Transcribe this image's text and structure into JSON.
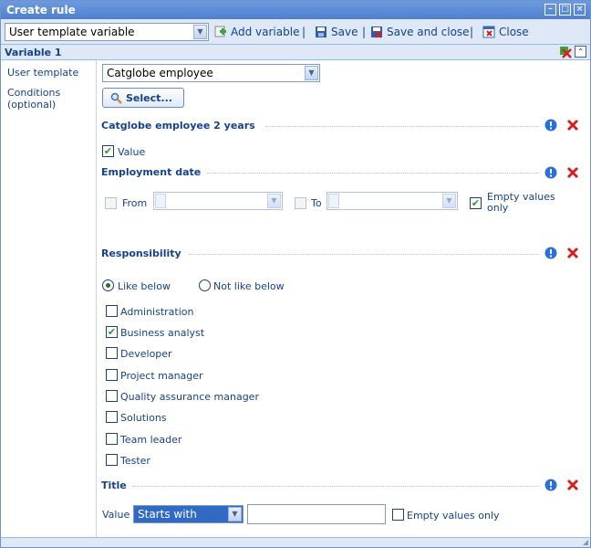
{
  "window": {
    "title": "Create rule"
  },
  "toolbar": {
    "type_select": "User template variable",
    "add_variable": "Add variable",
    "save": "Save",
    "save_close": "Save and close",
    "close": "Close",
    "separator": "|"
  },
  "variable": {
    "header": "Variable 1",
    "user_template_label": "User template",
    "user_template_value": "Catglobe employee",
    "conditions_label": "Conditions\n(optional)",
    "select_button": "Select..."
  },
  "sections": {
    "employee2y": {
      "title": "Catglobe employee 2 years",
      "value_label": "Value",
      "value_checked": true
    },
    "employment": {
      "title": "Employment date",
      "from_label": "From",
      "to_label": "To",
      "empty_label": "Empty values only",
      "empty_checked": true
    },
    "responsibility": {
      "title": "Responsibility",
      "like_label": "Like below",
      "not_like_label": "Not like below",
      "selected_mode": "like",
      "items": [
        {
          "label": "Administration",
          "checked": false
        },
        {
          "label": "Business analyst",
          "checked": true
        },
        {
          "label": "Developer",
          "checked": false
        },
        {
          "label": "Project manager",
          "checked": false
        },
        {
          "label": "Quality assurance manager",
          "checked": false
        },
        {
          "label": "Solutions",
          "checked": false
        },
        {
          "label": "Team leader",
          "checked": false
        },
        {
          "label": "Tester",
          "checked": false
        }
      ]
    },
    "title_section": {
      "title": "Title",
      "value_label": "Value",
      "operator": "Starts with",
      "input_value": "",
      "empty_label": "Empty values only",
      "empty_checked": false
    }
  },
  "colors": {
    "accent": "#15428b",
    "check": "#21a121",
    "delete": "#d42020",
    "info": "#2a6ee0"
  }
}
